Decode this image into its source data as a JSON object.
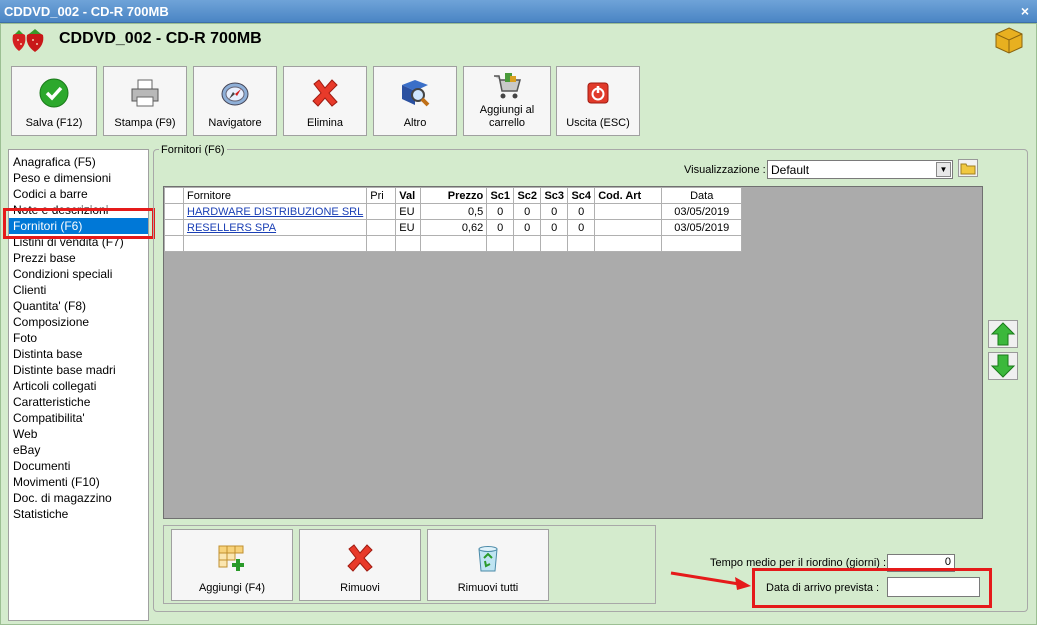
{
  "window": {
    "title": "CDDVD_002 - CD-R 700MB",
    "close_label": "×",
    "header_title": "CDDVD_002 - CD-R 700MB"
  },
  "toolbar": {
    "save": "Salva (F12)",
    "print": "Stampa (F9)",
    "navigator": "Navigatore",
    "delete": "Elimina",
    "other": "Altro",
    "cart_line1": "Aggiungi al",
    "cart_line2": "carrello",
    "exit": "Uscita (ESC)"
  },
  "nav": {
    "items": [
      "Anagrafica (F5)",
      "Peso e dimensioni",
      "Codici a barre",
      "Note e descrizioni",
      "Fornitori (F6)",
      "Listini di vendita (F7)",
      "Prezzi base",
      "Condizioni speciali",
      "Clienti",
      "Quantita' (F8)",
      "Composizione",
      "Foto",
      "Distinta base",
      "Distinte base madri",
      "Articoli collegati",
      "Caratteristiche",
      "Compatibilita'",
      "Web",
      "eBay",
      "Documenti",
      "Movimenti (F10)",
      "Doc. di magazzino",
      "Statistiche"
    ]
  },
  "panel": {
    "title": "Fornitori (F6)",
    "view_label": "Visualizzazione :",
    "view_value": "Default",
    "view_arrow": "▼"
  },
  "table": {
    "headers": {
      "fornitore": "Fornitore",
      "pri": "Pri",
      "val": "Val",
      "prezzo": "Prezzo",
      "sc1": "Sc1",
      "sc2": "Sc2",
      "sc3": "Sc3",
      "sc4": "Sc4",
      "codart": "Cod. Art",
      "data": "Data"
    },
    "rows": [
      {
        "fornitore": "HARDWARE DISTRIBUZIONE SRL",
        "pri": "",
        "val": "EU",
        "prezzo": "0,5",
        "sc1": "0",
        "sc2": "0",
        "sc3": "0",
        "sc4": "0",
        "codart": "",
        "data": "03/05/2019"
      },
      {
        "fornitore": "RESELLERS SPA",
        "pri": "",
        "val": "EU",
        "prezzo": "0,62",
        "sc1": "0",
        "sc2": "0",
        "sc3": "0",
        "sc4": "0",
        "codart": "",
        "data": "03/05/2019"
      }
    ]
  },
  "bottom": {
    "add": "Aggiungi (F4)",
    "remove": "Rimuovi",
    "remove_all": "Rimuovi tutti",
    "reorder_label": "Tempo medio per il riordino (giorni) :",
    "reorder_value": "0",
    "arrival_label": "Data di arrivo prevista :",
    "arrival_value": ""
  },
  "colors": {
    "background": "#d4ebcd",
    "selection": "#0078d7",
    "highlight": "#e51a1a"
  }
}
